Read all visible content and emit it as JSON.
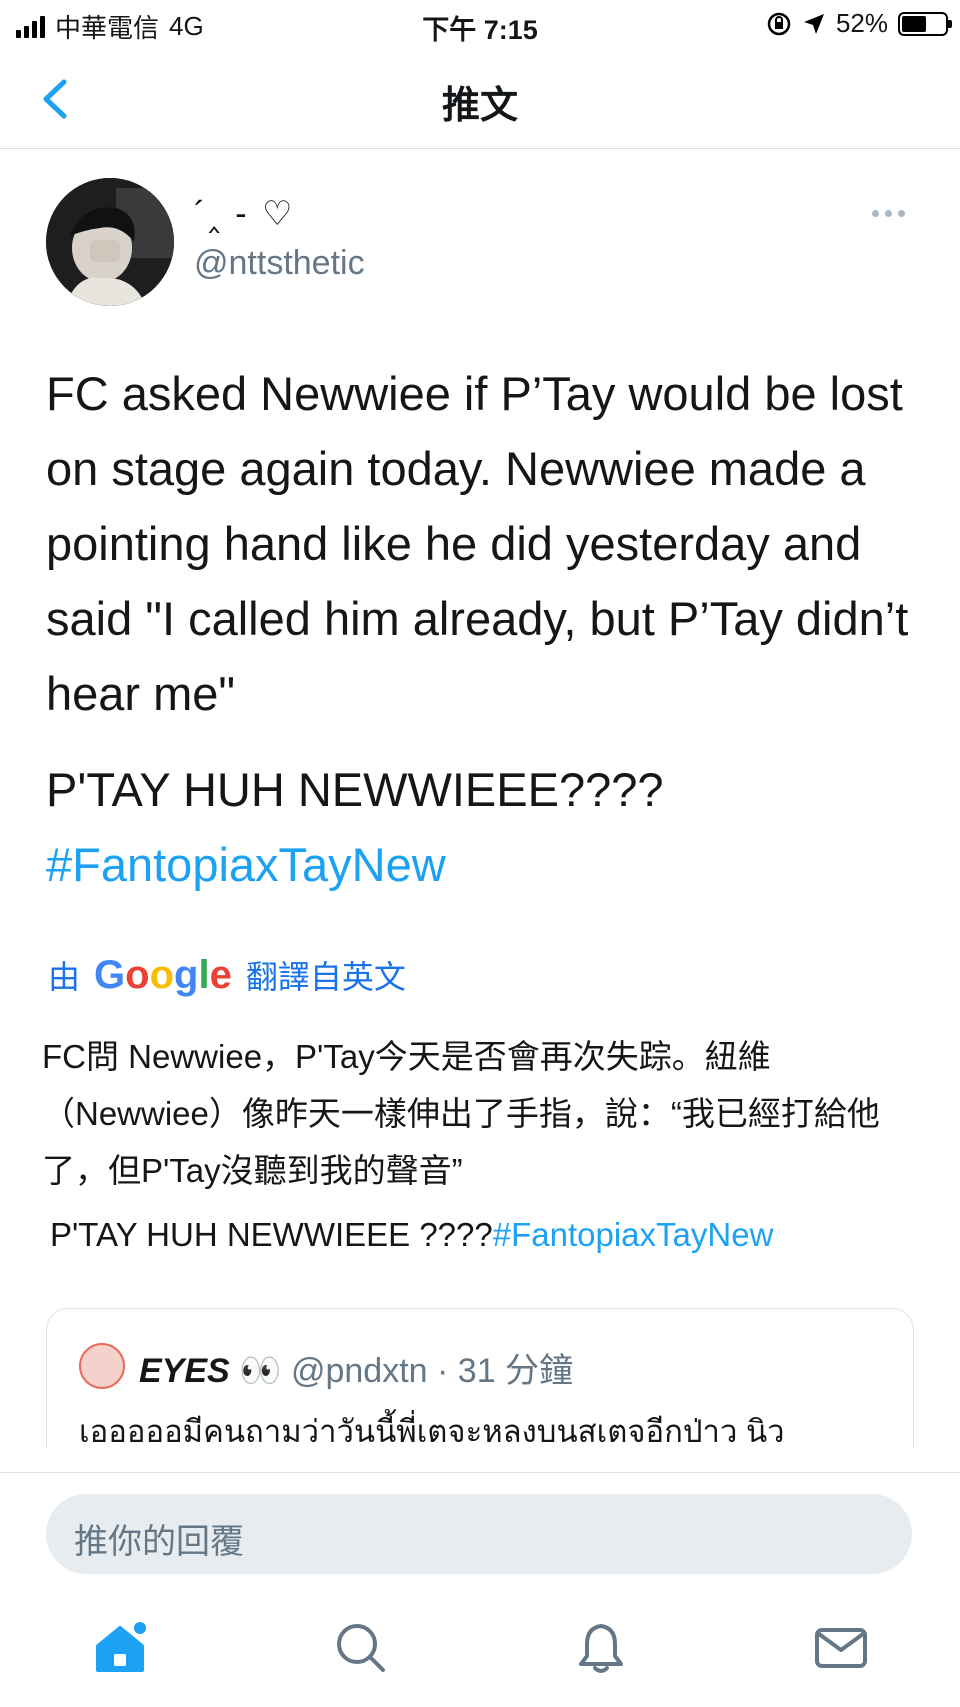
{
  "status_bar": {
    "carrier": "中華電信",
    "network": "4G",
    "time": "下午 7:15",
    "battery": "52%"
  },
  "nav": {
    "title": "推文",
    "back_icon": "chevron-left-icon"
  },
  "tweet": {
    "display_name": "´‸ - ♡",
    "handle": "@nttsthetic",
    "text": "FC asked Newwiee if P’Tay would be lost on stage again today. Newwiee made a pointing hand like he did yesterday and said \"I called him already, but P’Tay didn’t hear me\"",
    "text2": "P'TAY HUH NEWWIEEE????",
    "hashtag": "#FantopiaxTayNew"
  },
  "translation": {
    "prefix": "由",
    "provider": "Google",
    "suffix": "翻譯自英文",
    "text": "FC問 Newwiee，P'Tay今天是否會再次失踪。紐維（Newwiee）像昨天一樣伸出了手指，說：“我已經打給他了，但P'Tay沒聽到我的聲音”",
    "text2": "P'TAY HUH NEWWIEEE ????",
    "hashtag": "#FantopiaxTayNew"
  },
  "quoted_tweet": {
    "name": "EYES",
    "emoji": "👀",
    "handle": "@pndxtn",
    "time": "· 31 分鐘",
    "text": "เอออออมีคนถามว่าวันนี้พี่เตจะหลงบนสเตจอีกป่าว นิว"
  },
  "reply": {
    "placeholder": "推你的回覆"
  },
  "tabbar": {
    "items": [
      "home-icon",
      "search-icon",
      "notifications-icon",
      "messages-icon"
    ]
  },
  "colors": {
    "accent": "#1da1f2",
    "secondary_text": "#657786"
  }
}
